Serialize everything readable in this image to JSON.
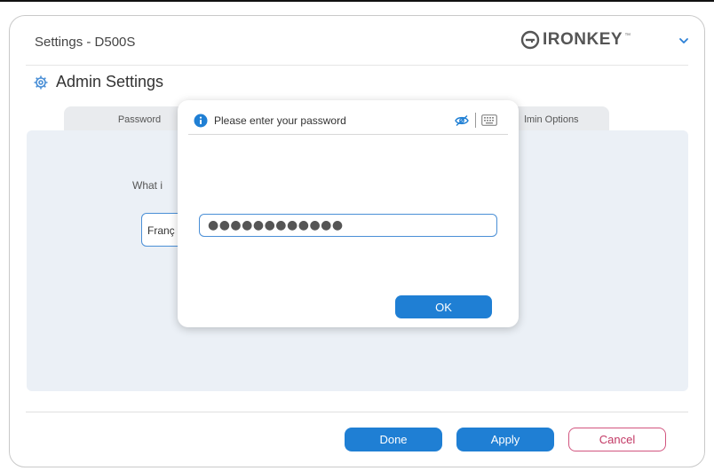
{
  "window": {
    "title": "Settings - D500S",
    "brand": {
      "name": "IRONKEY",
      "trademark": "™",
      "color": "#555555"
    },
    "menu_icon": "chevron-down-icon"
  },
  "admin": {
    "title": "Admin Settings",
    "icon": "gear-icon",
    "tabs": [
      {
        "label": "Password"
      },
      {
        "label": "lmin Options"
      }
    ],
    "question_partial": "What i",
    "language_field_partial": "Franç"
  },
  "footer": {
    "done_label": "Done",
    "apply_label": "Apply",
    "cancel_label": "Cancel"
  },
  "dialog": {
    "title": "Please enter your password",
    "icons": [
      "info-icon",
      "eye-off-icon",
      "keyboard-icon"
    ],
    "password_value": "●●●●●●●●●●●●",
    "ok_label": "OK"
  },
  "colors": {
    "accent": "#1F7FD4",
    "cancel_text": "#C23864",
    "panel_bg": "#EBF0F6"
  }
}
